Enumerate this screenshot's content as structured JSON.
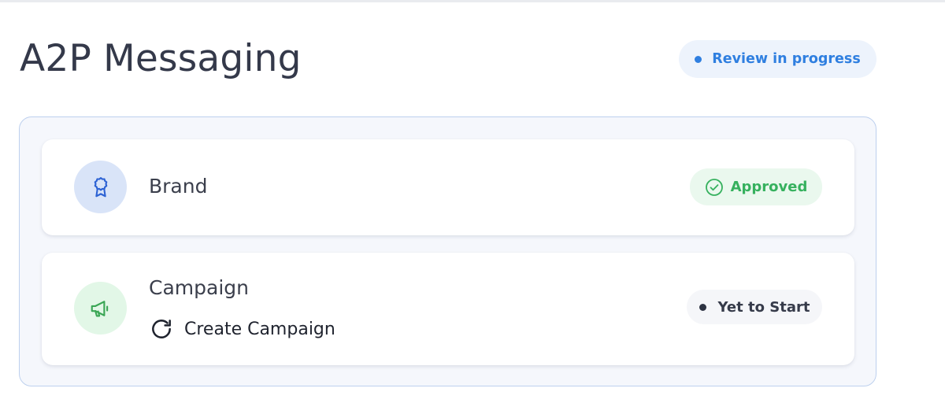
{
  "page": {
    "title": "A2P Messaging",
    "status_badge": "Review in progress"
  },
  "cards": {
    "brand": {
      "label": "Brand",
      "icon": "award-ribbon-icon",
      "status": "Approved"
    },
    "campaign": {
      "label": "Campaign",
      "icon": "megaphone-icon",
      "action": "Create Campaign",
      "action_icon": "refresh-icon",
      "status": "Yet to Start"
    }
  },
  "colors": {
    "accent_blue": "#2f7fe0",
    "approved_green": "#36b15e",
    "panel_border": "#bdd0ee",
    "text_dark": "#34394a"
  }
}
